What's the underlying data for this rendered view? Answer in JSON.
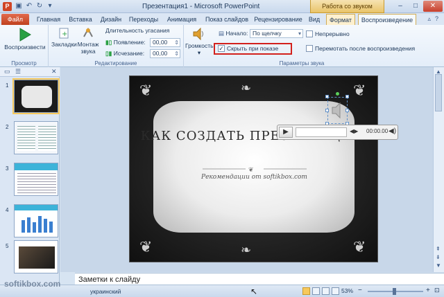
{
  "window": {
    "title": "Презентация1 - Microsoft PowerPoint",
    "context_group": "Работа со звуком",
    "app_letter": "P"
  },
  "tabs": [
    {
      "label": "Файл"
    },
    {
      "label": "Главная"
    },
    {
      "label": "Вставка"
    },
    {
      "label": "Дизайн"
    },
    {
      "label": "Переходы"
    },
    {
      "label": "Анимация"
    },
    {
      "label": "Показ слайдов"
    },
    {
      "label": "Рецензирование"
    },
    {
      "label": "Вид"
    },
    {
      "label": "Формат"
    },
    {
      "label": "Воспроизведение"
    }
  ],
  "ribbon": {
    "preview": {
      "play_label": "Воспроизвести",
      "group_label": "Просмотр"
    },
    "editing": {
      "bookmarks_label": "Закладки",
      "trim_label": "Монтаж звука",
      "fade_title": "Длительность угасания",
      "fade_in_label": "Появление:",
      "fade_in_value": "00,00",
      "fade_out_label": "Исчезание:",
      "fade_out_value": "00,00",
      "group_label": "Редактирование"
    },
    "audio_options": {
      "volume_label": "Громкость",
      "start_label": "Начало:",
      "start_value": "По щелчку",
      "hide_label": "Скрыть при показе",
      "hide_checked": true,
      "loop_label": "Непрерывно",
      "loop_checked": false,
      "rewind_label": "Перемотать после воспроизведения",
      "rewind_checked": false,
      "group_label": "Параметры звука"
    }
  },
  "slides": [
    {
      "number": "1",
      "selected": true
    },
    {
      "number": "2",
      "selected": false
    },
    {
      "number": "3",
      "selected": false
    },
    {
      "number": "4",
      "selected": false
    },
    {
      "number": "5",
      "selected": false
    }
  ],
  "slide": {
    "title": "КАК СОЗДАТЬ ПРЕЗЕНТАЦИЮ",
    "subtitle": "Рекомендации от softikbox.com"
  },
  "player": {
    "time": "00:00.00"
  },
  "notes": {
    "placeholder": "Заметки к слайду"
  },
  "status": {
    "language": "украинский",
    "zoom": "53%",
    "watermark": "softikbox.com"
  },
  "colors": {
    "file_tab": "#c0421f",
    "context_tab": "#e9c46a",
    "highlight": "#d3201c",
    "play_green": "#2aa043"
  }
}
